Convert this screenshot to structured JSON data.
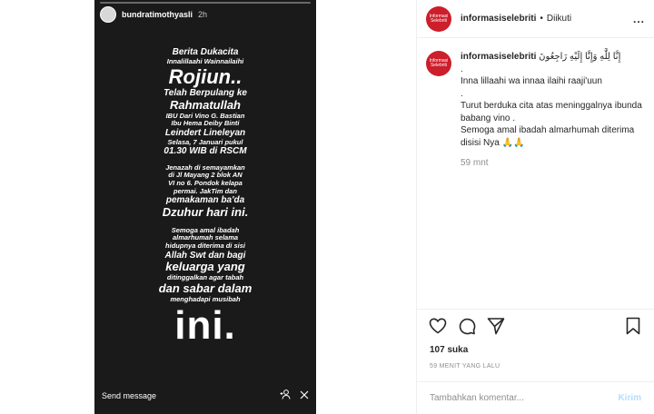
{
  "story": {
    "username": "bundratimothyasli",
    "time": "2h",
    "lines": {
      "l1": "Berita Dukacita",
      "l2": "Innalillaahi Wainnailaihi",
      "l3": "Rojiun..",
      "l4": "Telah Berpulang ke",
      "l5": "Rahmatullah",
      "l6": "IBU Dari Vino G. Bastian",
      "l7": "Ibu Hema Deiby Binti",
      "l8": "Leindert Lineleyan",
      "l9": "Selasa, 7 Januari pukul",
      "l10": "01.30 WIB di RSCM",
      "l11": "Jenazah di semayamkan",
      "l12": "di Jl Mayang 2 blok AN",
      "l13": "VI no 6. Pondok kelapa",
      "l14": "permai. JakTim dan",
      "l15": "pemakaman ba'da",
      "l16": "Dzuhur hari ini.",
      "l17": "Semoga amal ibadah",
      "l18": "almarhumah selama",
      "l19": "hidupnya diterima di sisi",
      "l20": "Allah Swt dan bagi",
      "l21": "keluarga yang",
      "l22": "ditinggalkan agar tabah",
      "l23": "dan sabar dalam",
      "l24": "menghadapi musibah",
      "l25": "ini."
    },
    "send_message": "Send message",
    "icons": [
      "add-user-icon",
      "share-icon"
    ]
  },
  "header": {
    "account": "informasiselebriti",
    "dot": "•",
    "follow_status": "Diikuti",
    "more": "..."
  },
  "avatar_text": "Informasi Selebriti",
  "caption": {
    "account": "informasiselebriti",
    "arabic": "إِنَّا لِلَّٰهِ وَإِنَّا إِلَيْهِ رَاجِعُونَ",
    "c1": ".",
    "c2": "Inna lillaahi wa innaa ilaihi raaji'uun",
    "c3": ".",
    "c4": "Turut berduka cita atas meninggalnya ibunda babang vino .",
    "c5": "Semoga amal ibadah almarhumah diterima disisi Nya 🙏🙏",
    "time": "59 mnt"
  },
  "likes": "107 suka",
  "post_time": "59 MENIT YANG LALU",
  "comment": {
    "placeholder": "Tambahkan komentar...",
    "post_label": "Kirim"
  }
}
